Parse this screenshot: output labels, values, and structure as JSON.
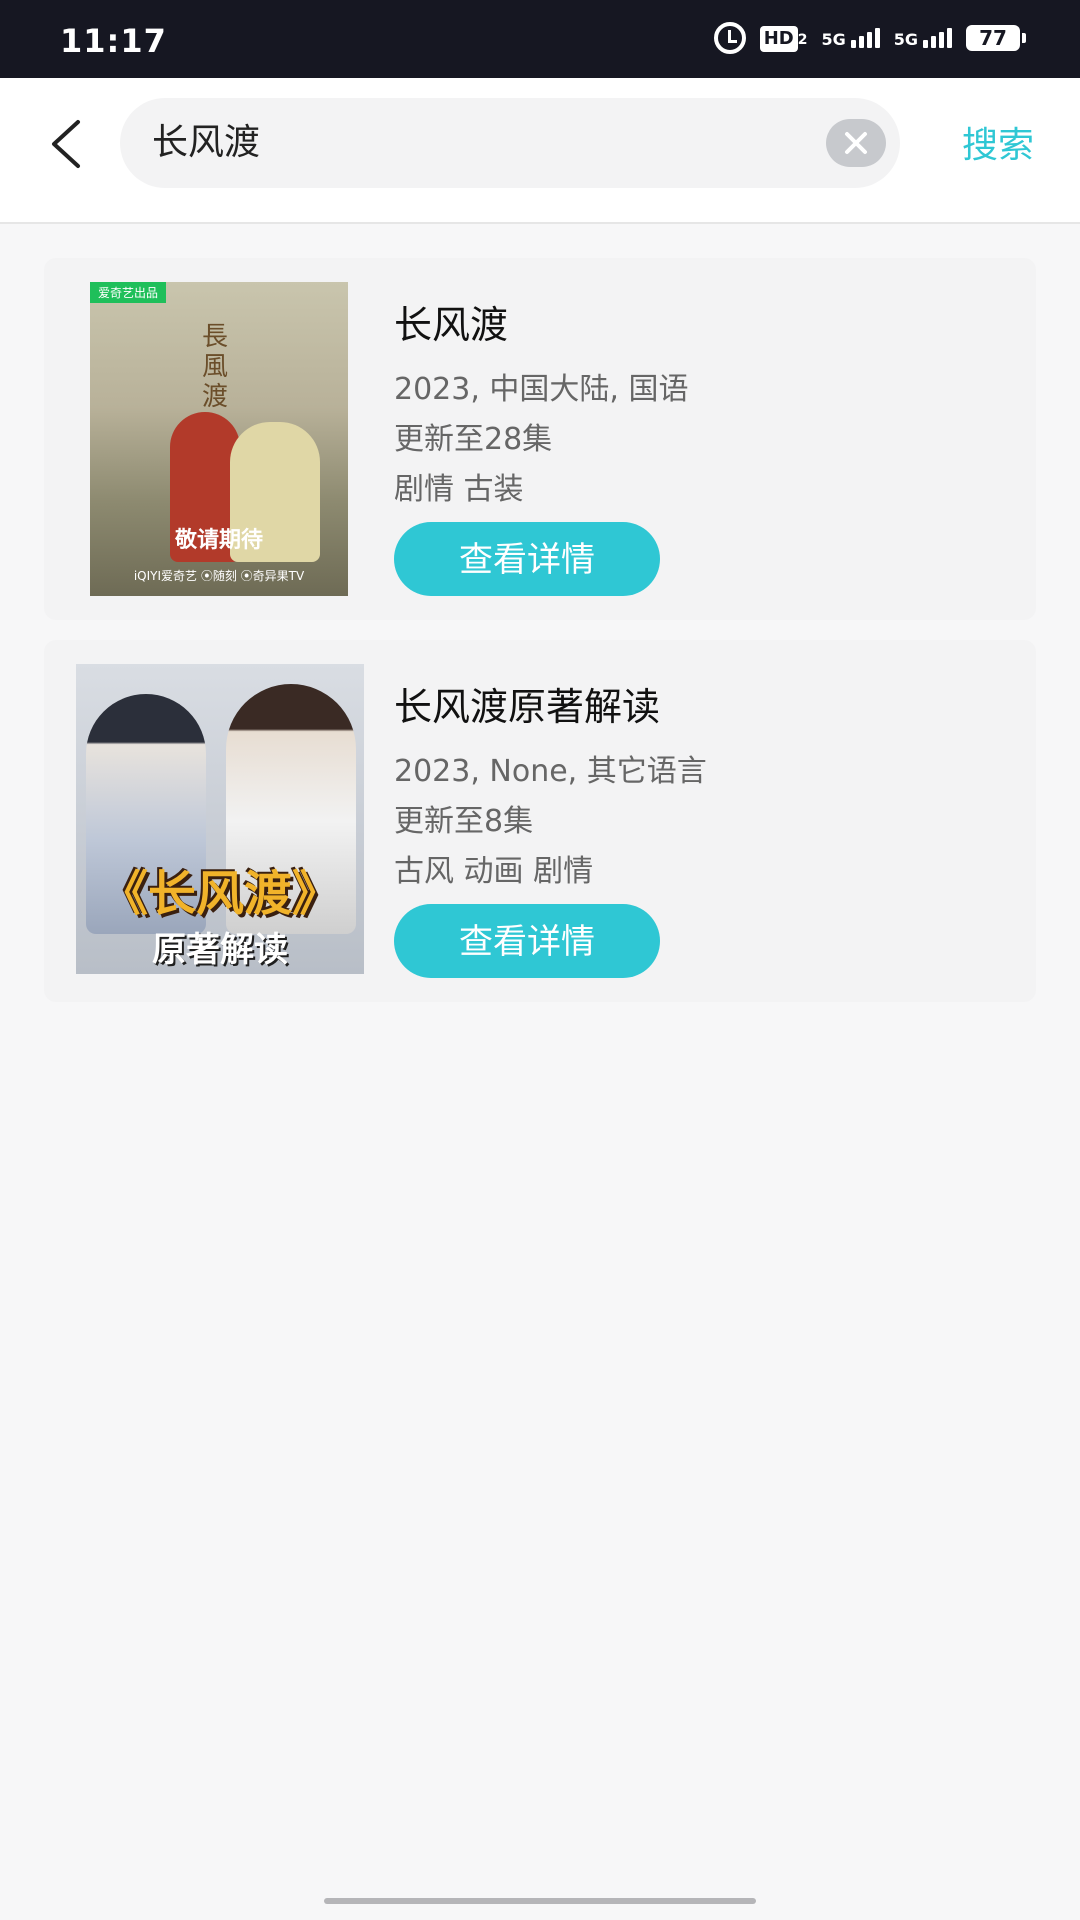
{
  "status_bar": {
    "time": "11:17",
    "hd_label": "HD",
    "hd_sub": "2",
    "network_1": "5G",
    "network_2": "5G",
    "battery": "77"
  },
  "header": {
    "search_value": "长风渡",
    "search_button": "搜索"
  },
  "results": [
    {
      "title": "长风渡",
      "meta": "2023, 中国大陆, 国语",
      "episodes": "更新至28集",
      "genres": "剧情 古装",
      "detail_button": "查看详情",
      "poster": {
        "tag": "爱奇艺出品",
        "calligraphy": "長風渡",
        "caption": "敬请期待",
        "platforms": "iQIYI爱奇艺 ⦿随刻 ⦿奇异果TV"
      }
    },
    {
      "title": "长风渡原著解读",
      "meta": "2023, None, 其它语言",
      "episodes": "更新至8集",
      "genres": "古风 动画 剧情",
      "detail_button": "查看详情",
      "poster": {
        "banner": "《长风渡》",
        "sub_banner": "原著解读"
      }
    }
  ]
}
